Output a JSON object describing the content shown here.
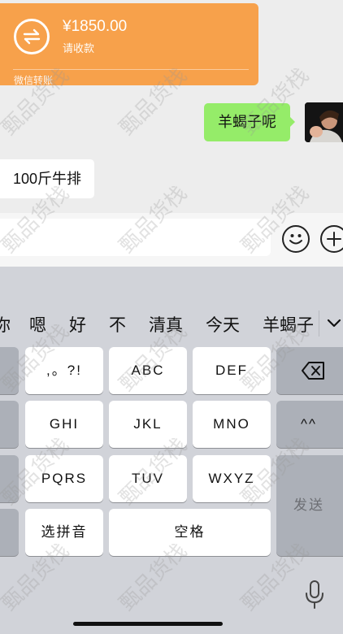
{
  "transfer": {
    "amount": "¥1850.00",
    "subtitle": "请收款",
    "footer": "微信转账"
  },
  "messages": {
    "right_text": "羊蝎子呢",
    "left_text": "100斤牛排"
  },
  "candidates": [
    "你",
    "嗯",
    "好",
    "不",
    "清真",
    "今天",
    "羊蝎子"
  ],
  "keys": {
    "punct": ",。?!",
    "abc": "ABC",
    "def": "DEF",
    "ghi": "GHI",
    "jkl": "JKL",
    "mno": "MNO",
    "pqrs": "PQRS",
    "tuv": "TUV",
    "wxyz": "WXYZ",
    "pinyin": "选拼音",
    "space": "空格",
    "send": "发送",
    "face": "^^"
  },
  "watermark": "甄品货栈",
  "colors": {
    "transfer": "#f7a14b",
    "bubble_right": "#95ec69",
    "keyboard_bg": "#d1d3d9"
  }
}
